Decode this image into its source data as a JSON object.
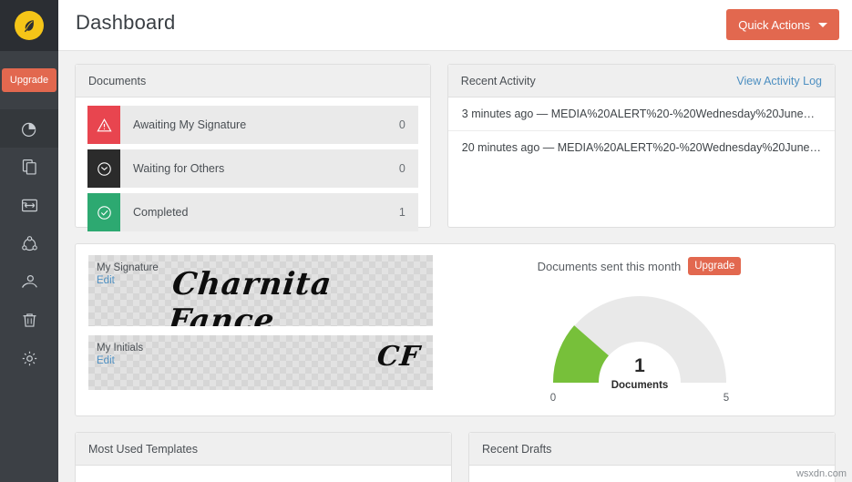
{
  "sidebar": {
    "logo_icon": "quill-logo-icon",
    "logo_color": "#f5c518",
    "upgrade_label": "Upgrade",
    "items": [
      {
        "label": "Dashboard",
        "icon": "pie-chart-icon",
        "active": true
      },
      {
        "label": "Documents",
        "icon": "documents-copy-icon",
        "active": false
      },
      {
        "label": "Templates",
        "icon": "template-resize-icon",
        "active": false
      },
      {
        "label": "Team",
        "icon": "team-network-icon",
        "active": false
      },
      {
        "label": "Contacts",
        "icon": "contact-user-icon",
        "active": false
      },
      {
        "label": "Trash",
        "icon": "trash-icon",
        "active": false
      },
      {
        "label": "Settings",
        "icon": "gear-icon",
        "active": false
      }
    ]
  },
  "header": {
    "title": "Dashboard",
    "quick_actions_label": "Quick Actions",
    "quick_actions_icon": "chevron-down-icon",
    "accent_color": "#e2684f"
  },
  "documents_panel": {
    "title": "Documents",
    "rows": [
      {
        "label": "Awaiting My Signature",
        "count": "0",
        "icon": "warning-triangle-icon",
        "color": "#e8454f"
      },
      {
        "label": "Waiting for Others",
        "count": "0",
        "icon": "clock-icon",
        "color": "#2b2b2b"
      },
      {
        "label": "Completed",
        "count": "1",
        "icon": "check-circle-icon",
        "color": "#2da971"
      }
    ]
  },
  "activity_panel": {
    "title": "Recent Activity",
    "link_label": "View Activity Log",
    "rows": [
      {
        "text": "3 minutes ago — MEDIA%20ALERT%20-%20Wednesday%20June…"
      },
      {
        "text": "20 minutes ago — MEDIA%20ALERT%20-%20Wednesday%20June…"
      }
    ]
  },
  "signature": {
    "signature_title": "My Signature",
    "signature_edit": "Edit",
    "signature_text": "Charnita Fance",
    "initials_title": "My Initials",
    "initials_edit": "Edit",
    "initials_text": "CF"
  },
  "gauge": {
    "caption": "Documents sent this month",
    "upgrade_label": "Upgrade",
    "value": "1",
    "unit": "Documents",
    "min_label": "0",
    "max_label": "5",
    "fill_color": "#77c03a",
    "track_color": "#e9e9e9"
  },
  "chart_data": {
    "type": "gauge",
    "title": "Documents sent this month",
    "value": 1,
    "unit": "Documents",
    "min": 0,
    "max": 5,
    "tick_labels": [
      "0",
      "5"
    ],
    "fill_color": "#77c03a",
    "track_color": "#e9e9e9",
    "grid": false,
    "legend": "none"
  },
  "bottom": {
    "templates_title": "Most Used Templates",
    "drafts_title": "Recent Drafts"
  },
  "watermark": "wsxdn.com"
}
